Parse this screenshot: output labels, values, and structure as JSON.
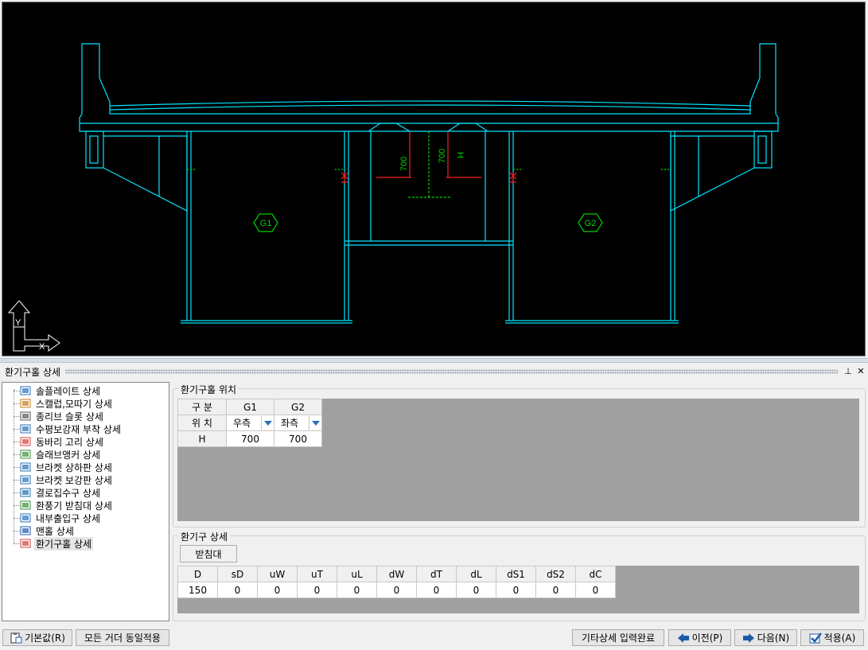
{
  "viewport": {
    "marker_labels": [
      "G1",
      "G2"
    ],
    "dimension_labels": [
      "700",
      "700",
      "H"
    ],
    "axis_labels": {
      "x": "X",
      "y": "Y"
    },
    "colors": {
      "background": "#000000",
      "girder": "#00e5ff",
      "annotation": "#00d400",
      "dimension": "#ff2020"
    }
  },
  "panel": {
    "title": "환기구홀 상세",
    "pin_icon": "pin-icon",
    "close_icon": "close-icon",
    "pin_glyph": "⊥",
    "close_glyph": "✕"
  },
  "tree": {
    "items": [
      {
        "label": "솔플레이트 상세",
        "icon": "sole-plate-icon"
      },
      {
        "label": "스캘럽,모따기 상세",
        "icon": "scallop-icon"
      },
      {
        "label": "종리브 슬롯 상세",
        "icon": "rib-slot-icon"
      },
      {
        "label": "수평보강재 부착 상세",
        "icon": "stiffener-icon"
      },
      {
        "label": "동바리 고리 상세",
        "icon": "hook-icon"
      },
      {
        "label": "슬래브앵커 상세",
        "icon": "anchor-icon"
      },
      {
        "label": "브라켓 상하판 상세",
        "icon": "bracket-flange-icon"
      },
      {
        "label": "브라켓 보강판 상세",
        "icon": "bracket-plate-icon"
      },
      {
        "label": "결로집수구 상세",
        "icon": "drain-icon"
      },
      {
        "label": "환풍기 받침대 상세",
        "icon": "fan-support-icon"
      },
      {
        "label": "내부출입구 상세",
        "icon": "access-icon"
      },
      {
        "label": "맨홀 상세",
        "icon": "manhole-icon"
      },
      {
        "label": "환기구홀 상세",
        "icon": "vent-hole-icon",
        "selected": true
      }
    ]
  },
  "position_group": {
    "title": "환기구홀 위치",
    "headers": [
      "구 분",
      "G1",
      "G2"
    ],
    "row_position_label": "위 치",
    "row_position_values": [
      "우측",
      "좌측"
    ],
    "row_h_label": "H",
    "row_h_values": [
      "700",
      "700"
    ]
  },
  "detail_group": {
    "title": "환기구 상세",
    "tab_label": "받침대",
    "headers": [
      "D",
      "sD",
      "uW",
      "uT",
      "uL",
      "dW",
      "dT",
      "dL",
      "dS1",
      "dS2",
      "dC"
    ],
    "values": [
      "150",
      "0",
      "0",
      "0",
      "0",
      "0",
      "0",
      "0",
      "0",
      "0",
      "0"
    ]
  },
  "buttons": {
    "default": "기본값(R)",
    "apply_all": "모든 거더 동일적용",
    "finish": "기타상세 입력완료",
    "prev": "이전(P)",
    "next": "다음(N)",
    "apply": "적용(A)"
  }
}
